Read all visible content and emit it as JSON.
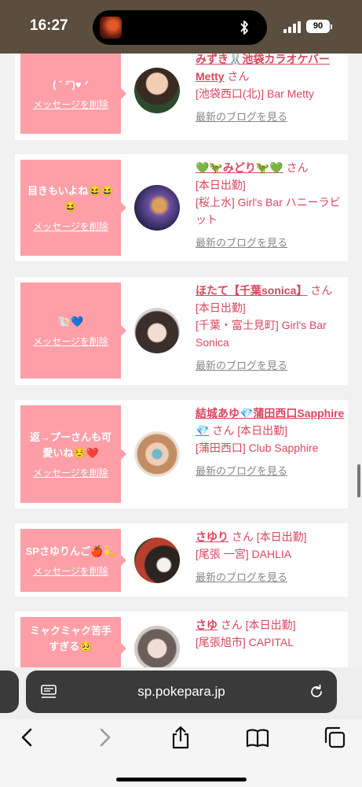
{
  "status_bar": {
    "time": "16:27",
    "battery": "90"
  },
  "messages": [
    {
      "message": "( ˘ ³˘)♥ ᐟ",
      "delete_label": "メッセージを削除",
      "name": "みずき🐰池袋カラオケバーMetty",
      "san": "さん",
      "status": "",
      "shop": "[池袋西口(北)] Bar Metty",
      "blog_link": "最新のブログを見る"
    },
    {
      "message": "目きもいよね😆😆😆",
      "delete_label": "メッセージを削除",
      "name": "💚🦖みどり🦖💚",
      "san": "さん",
      "status": "[本日出勤]",
      "shop": "[桜上水] Girl's Bar ハニーラビット",
      "blog_link": "最新のブログを見る"
    },
    {
      "message": "🐚💙",
      "delete_label": "メッセージを削除",
      "name": "ほたて【千葉sonica】",
      "san": "さん",
      "status": "[本日出勤]",
      "shop": "[千葉・富士見町] Girl's Bar Sonica",
      "blog_link": "最新のブログを見る"
    },
    {
      "message": "返→プーさんも可愛いね☺️❤️",
      "delete_label": "メッセージを削除",
      "name": "結城あゆ💎蒲田西口Sapphire💎",
      "san": "さん",
      "status": "[本日出勤]",
      "shop": "[蒲田西口] Club Sapphire",
      "blog_link": "最新のブログを見る"
    },
    {
      "message": "SPさゆりんご🍎💫",
      "delete_label": "メッセージを削除",
      "name": "さゆり",
      "san": "さん",
      "status": "[本日出勤]",
      "shop": "[尾張 一宮] DAHLIA",
      "blog_link": "最新のブログを見る"
    },
    {
      "message": "ミャクミャク苦手すぎる🥺",
      "delete_label": "メッセージを削除",
      "name": "さゆ",
      "san": "さん",
      "status": "[本日出勤]",
      "shop": "[尾張旭市] CAPITAL",
      "blog_link": ""
    }
  ],
  "browser": {
    "url": "sp.pokepara.jp"
  },
  "icons": [
    "bluetooth-icon",
    "signal-icon",
    "battery-icon",
    "reader-icon",
    "reload-icon",
    "back-icon",
    "forward-icon",
    "share-icon",
    "bookmarks-icon",
    "tabs-icon"
  ],
  "colors": {
    "accent": "#d9475f",
    "bubble": "#fe9fa7",
    "status_bar": "#5b4e3f"
  }
}
